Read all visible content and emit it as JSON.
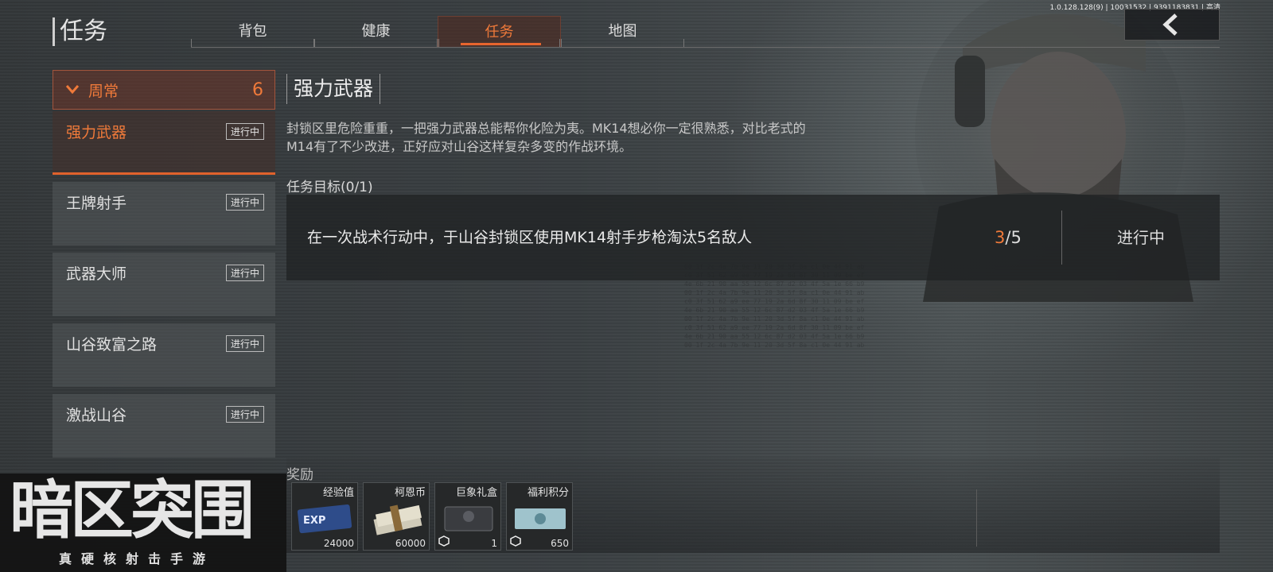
{
  "header": {
    "title": "任务",
    "tabs": [
      {
        "label": "背包",
        "active": false
      },
      {
        "label": "健康",
        "active": false
      },
      {
        "label": "任务",
        "active": true
      },
      {
        "label": "地图",
        "active": false
      }
    ],
    "version": "1.0.128.128(9) | 10031532 | 9391183831 | 高清"
  },
  "category": {
    "label": "周常",
    "count": "6"
  },
  "tasks": [
    {
      "name": "强力武器",
      "status": "进行中",
      "active": true
    },
    {
      "name": "王牌射手",
      "status": "进行中",
      "active": false
    },
    {
      "name": "武器大师",
      "status": "进行中",
      "active": false
    },
    {
      "name": "山谷致富之路",
      "status": "进行中",
      "active": false
    },
    {
      "name": "激战山谷",
      "status": "进行中",
      "active": false
    }
  ],
  "detail": {
    "title": "强力武器",
    "description": "封锁区里危险重重，一把强力武器总能帮你化险为夷。MK14想必你一定很熟悉，对比老式的M14有了不少改进，正好应对山谷这样复杂多变的作战环境。",
    "objectives_header": "任务目标(0/1)",
    "objective": {
      "text": "在一次战术行动中，于山谷封锁区使用MK14射手步枪淘汰5名敌人",
      "current": "3",
      "total": "/5",
      "status": "进行中"
    },
    "rewards_label": "奖励",
    "rewards": [
      {
        "name": "经验值",
        "amount": "24000",
        "icon": "exp-ticket-icon"
      },
      {
        "name": "柯恩币",
        "amount": "60000",
        "icon": "cash-stack-icon"
      },
      {
        "name": "巨象礼盒",
        "amount": "1",
        "icon": "gift-box-icon"
      },
      {
        "name": "福利积分",
        "amount": "650",
        "icon": "points-ticket-icon"
      }
    ]
  },
  "logo": {
    "title": "暗区突围",
    "subtitle": "真硬核射击手游"
  },
  "colors": {
    "accent": "#f07a3a",
    "accent_line": "#e8652e",
    "panel_dark": "#202224"
  }
}
